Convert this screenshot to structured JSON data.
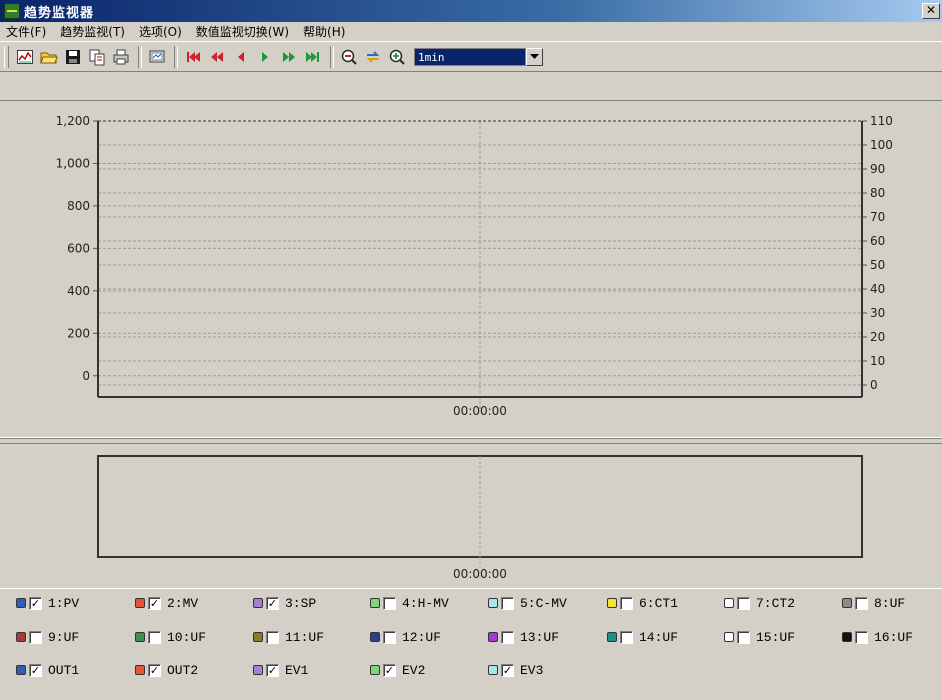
{
  "window": {
    "title": "趋势监视器",
    "close_label": "✕"
  },
  "menu": [
    {
      "label": "文件(F)"
    },
    {
      "label": "趋势监视(T)"
    },
    {
      "label": "选项(O)"
    },
    {
      "label": "数值监视切换(W)"
    },
    {
      "label": "帮助(H)"
    }
  ],
  "toolbar": {
    "buttons": [
      {
        "icon": "trend-chart-icon"
      },
      {
        "icon": "open-folder-icon"
      },
      {
        "icon": "save-icon"
      },
      {
        "icon": "copy-icon"
      },
      {
        "icon": "print-icon"
      },
      {
        "icon": "monitor-icon"
      },
      {
        "icon": "skip-first-icon"
      },
      {
        "icon": "fast-rewind-icon"
      },
      {
        "icon": "step-back-icon"
      },
      {
        "icon": "step-forward-icon"
      },
      {
        "icon": "fast-forward-icon"
      },
      {
        "icon": "skip-last-icon"
      },
      {
        "icon": "zoom-out-icon"
      },
      {
        "icon": "swap-icon"
      },
      {
        "icon": "zoom-in-icon"
      }
    ],
    "time_scale": "1min"
  },
  "chart_data": [
    {
      "type": "line",
      "x": [
        "00:00:00"
      ],
      "series": [],
      "ylim": [
        -100,
        1200
      ],
      "yticks": [
        "0",
        "200",
        "400",
        "600",
        "800",
        "1,000",
        "1,200"
      ],
      "y2lim": [
        -5,
        110
      ],
      "y2ticks": [
        "0",
        "10",
        "20",
        "30",
        "40",
        "50",
        "60",
        "70",
        "80",
        "90",
        "100",
        "110"
      ],
      "grid": true
    },
    {
      "type": "line",
      "x": [
        "00:00:00"
      ],
      "series": [],
      "grid": false
    }
  ],
  "legend": [
    {
      "label": "1:PV",
      "color": "#2e5fb0",
      "checked": true
    },
    {
      "label": "2:MV",
      "color": "#e5533a",
      "checked": true
    },
    {
      "label": "3:SP",
      "color": "#a77fcf",
      "checked": true
    },
    {
      "label": "4:H-MV",
      "color": "#7fd67a",
      "checked": false
    },
    {
      "label": "5:C-MV",
      "color": "#a9e4ec",
      "checked": false
    },
    {
      "label": "6:CT1",
      "color": "#f5e52a",
      "checked": false
    },
    {
      "label": "7:CT2",
      "color": "#ffffff",
      "checked": false
    },
    {
      "label": "8:UF",
      "color": "#8a8a8a",
      "checked": false
    },
    {
      "label": "9:UF",
      "color": "#a53a3a",
      "checked": false
    },
    {
      "label": "10:UF",
      "color": "#3e8f4a",
      "checked": false
    },
    {
      "label": "11:UF",
      "color": "#8a7a2a",
      "checked": false
    },
    {
      "label": "12:UF",
      "color": "#2a3f8f",
      "checked": false
    },
    {
      "label": "13:UF",
      "color": "#a23ad0",
      "checked": false
    },
    {
      "label": "14:UF",
      "color": "#1a8f8f",
      "checked": false
    },
    {
      "label": "15:UF",
      "color": "#ffffff",
      "checked": false
    },
    {
      "label": "16:UF",
      "color": "#111111",
      "checked": false
    },
    {
      "label": "OUT1",
      "color": "#2e5fb0",
      "checked": true
    },
    {
      "label": "OUT2",
      "color": "#e5533a",
      "checked": true
    },
    {
      "label": "EV1",
      "color": "#a77fcf",
      "checked": true
    },
    {
      "label": "EV2",
      "color": "#7fd67a",
      "checked": true
    },
    {
      "label": "EV3",
      "color": "#a9e4ec",
      "checked": true
    }
  ]
}
